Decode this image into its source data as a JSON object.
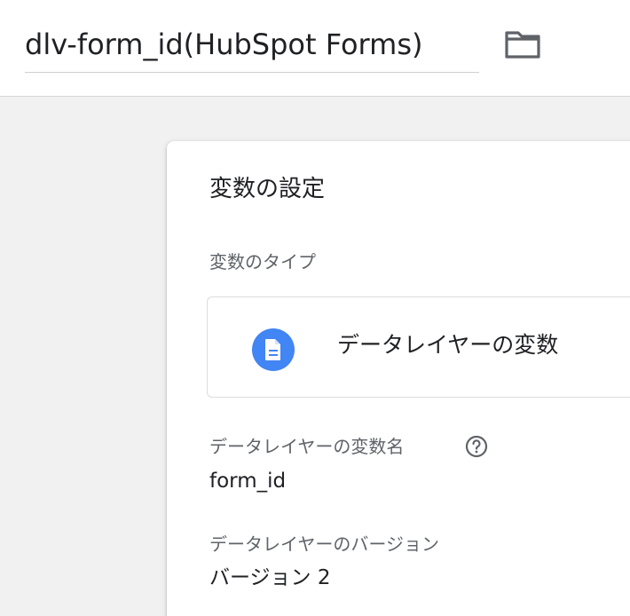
{
  "header": {
    "title": "dlv-form_id(HubSpot Forms)",
    "folder_icon": "folder-icon"
  },
  "card": {
    "title": "変数の設定",
    "type_label": "変数のタイプ",
    "type_name": "データレイヤーの変数",
    "type_icon": "document-icon",
    "fields": {
      "var_name_label": "データレイヤーの変数名",
      "var_name_value": "form_id",
      "help_icon": "help-circle-icon",
      "version_label": "データレイヤーのバージョン",
      "version_value": "バージョン 2"
    }
  },
  "colors": {
    "accent": "#4285f4",
    "text_primary": "#202124",
    "text_secondary": "#5f6368",
    "background": "#f1f1f1"
  }
}
